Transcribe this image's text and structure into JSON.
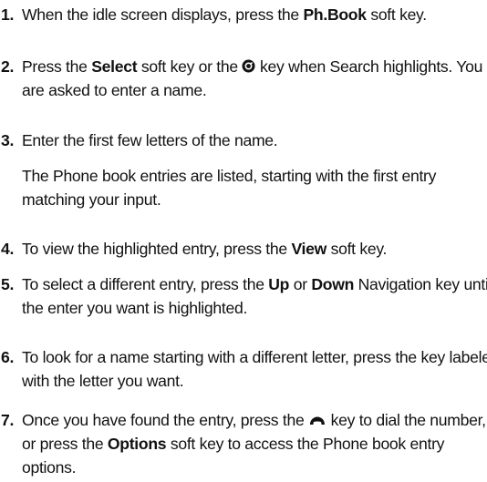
{
  "steps": [
    {
      "num": "1.",
      "parts": [
        "When the idle screen displays, press the ",
        "Ph.Book",
        " soft key."
      ]
    },
    {
      "num": "2.",
      "parts": [
        "Press the ",
        "Select",
        " soft key or the ",
        " key when Search highlights. You are asked to enter a name."
      ]
    },
    {
      "num": "3.",
      "text": "Enter the first few letters of the name.",
      "note": "The Phone book entries are listed, starting with the first entry matching your input."
    },
    {
      "num": "4.",
      "parts": [
        "To view the highlighted entry, press the ",
        "View",
        " soft key."
      ]
    },
    {
      "num": "5.",
      "parts": [
        "To select a different entry, press the ",
        "Up",
        " or ",
        "Down",
        " Navigation key until the enter you want is highlighted."
      ]
    },
    {
      "num": "6.",
      "text": "To look for a name starting with a different letter, press the key labeled with the letter you want."
    },
    {
      "num": "7.",
      "parts": [
        "Once you have found the entry, press the ",
        " key to dial the number, or press the ",
        "Options",
        " soft key to access the Phone book entry options."
      ]
    }
  ],
  "icons": {
    "ok_key": "ok-key-icon",
    "send_key": "send-key-icon"
  }
}
